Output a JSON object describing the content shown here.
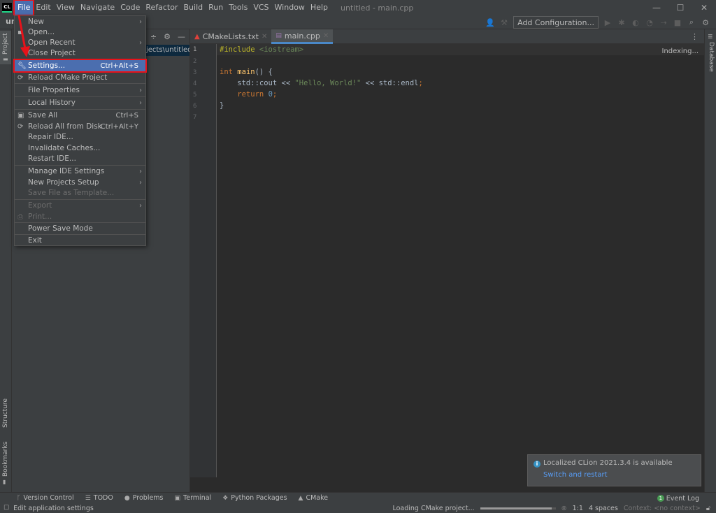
{
  "app": {
    "logo": "CL",
    "window_title": "untitled - main.cpp"
  },
  "menubar": [
    "File",
    "Edit",
    "View",
    "Navigate",
    "Code",
    "Refactor",
    "Build",
    "Run",
    "Tools",
    "VCS",
    "Window",
    "Help"
  ],
  "navbar": {
    "project": "un"
  },
  "toolbar": {
    "add_configuration": "Add Configuration..."
  },
  "stripes": {
    "left_top": "Project",
    "left_structure": "Structure",
    "left_bookmarks": "Bookmarks",
    "right": "Database"
  },
  "project_panel": {
    "selected_path": "jects\\untitled"
  },
  "tabs": [
    {
      "label": "CMakeLists.txt",
      "active": false
    },
    {
      "label": "main.cpp",
      "active": true
    }
  ],
  "editor": {
    "status": "Indexing...",
    "line_numbers": [
      "1",
      "2",
      "3",
      "4",
      "5",
      "6",
      "7"
    ],
    "lines": [
      "#include <iostream>",
      "",
      "int main() {",
      "    std::cout << \"Hello, World!\" << std::endl;",
      "    return 0;",
      "}",
      ""
    ]
  },
  "file_menu": {
    "items": [
      {
        "label": "New",
        "submenu": true
      },
      {
        "label": "Open...",
        "icon": "folder-icon"
      },
      {
        "label": "Open Recent",
        "submenu": true
      },
      {
        "label": "Close Project"
      },
      {
        "label": "Settings...",
        "shortcut": "Ctrl+Alt+S",
        "icon": "wrench-icon",
        "selected": true
      },
      {
        "label": "Reload CMake Project",
        "icon": "reload-icon"
      },
      {
        "label": "File Properties",
        "submenu": true
      },
      {
        "label": "Local History",
        "submenu": true
      },
      {
        "label": "Save All",
        "shortcut": "Ctrl+S",
        "icon": "save-icon"
      },
      {
        "label": "Reload All from Disk",
        "shortcut": "Ctrl+Alt+Y",
        "icon": "reload-icon"
      },
      {
        "label": "Repair IDE..."
      },
      {
        "label": "Invalidate Caches..."
      },
      {
        "label": "Restart IDE..."
      },
      {
        "label": "Manage IDE Settings",
        "submenu": true
      },
      {
        "label": "New Projects Setup",
        "submenu": true
      },
      {
        "label": "Save File as Template...",
        "disabled": true
      },
      {
        "label": "Export",
        "submenu": true,
        "disabled": true
      },
      {
        "label": "Print...",
        "icon": "print-icon",
        "disabled": true
      },
      {
        "label": "Power Save Mode"
      },
      {
        "label": "Exit"
      }
    ]
  },
  "notification": {
    "text": "Localized CLion 2021.3.4 is available",
    "link": "Switch and restart"
  },
  "bottom_tools": [
    "Version Control",
    "TODO",
    "Problems",
    "Terminal",
    "Python Packages",
    "CMake"
  ],
  "event_log": {
    "label": "Event Log",
    "count": "1"
  },
  "statusbar": {
    "hint": "Edit application settings",
    "loading": "Loading CMake project...",
    "progress": 0.95,
    "position": "1:1",
    "indent": "4 spaces",
    "context": "Context: <no context>"
  },
  "colors": {
    "accent": "#4b6eaf",
    "highlight_annotation": "#e8121a",
    "link": "#589df6"
  }
}
